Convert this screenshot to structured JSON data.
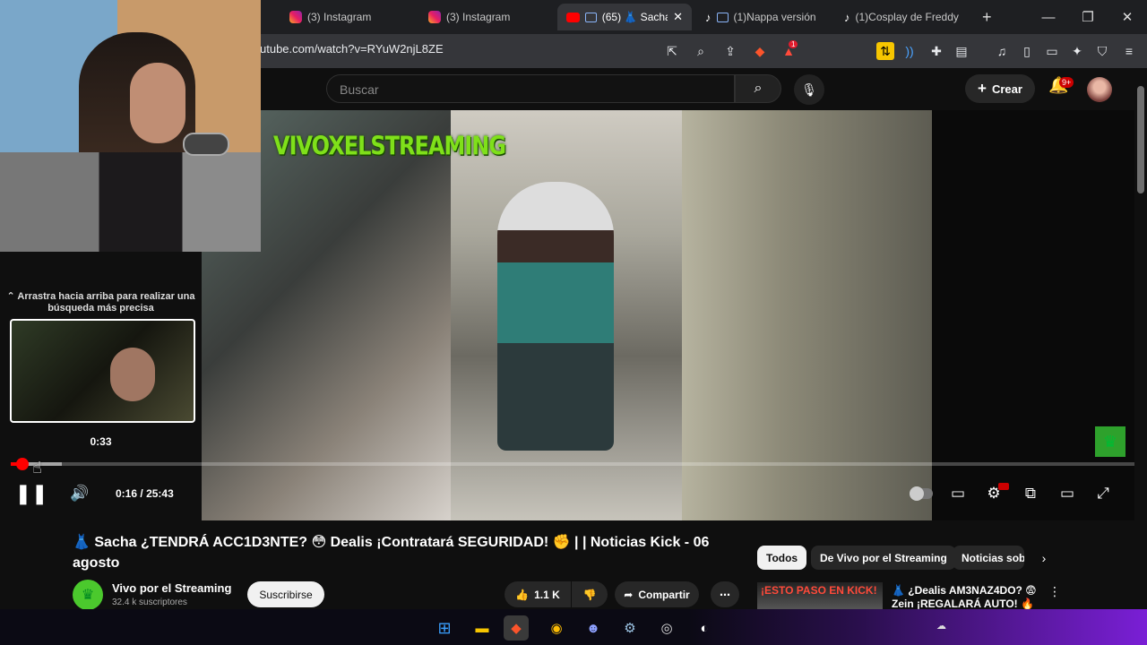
{
  "browser": {
    "tabs": [
      {
        "label": "(3) Instagram",
        "icon": "instagram-icon"
      },
      {
        "label": "(3) Instagram",
        "icon": "instagram-icon"
      },
      {
        "label": "(65) 👗 Sacha",
        "icon": "youtube-icon",
        "active": true
      },
      {
        "label": "(1)Nappa versión",
        "icon": "tiktok-icon"
      },
      {
        "label": "(1)Cosplay de Freddy",
        "icon": "tiktok-icon"
      }
    ],
    "new_tab": "+",
    "url": "utube.com/watch?v=RYuW2njL8ZE",
    "brave_badge": "1"
  },
  "youtube": {
    "search_placeholder": "Buscar",
    "create_label": "Crear",
    "notif_badge": "9+"
  },
  "video": {
    "watermark": "VIVOXELSTREAMING",
    "current_time": "0:16",
    "separator": "/",
    "duration": "25:43",
    "progress_fraction": 0.0104,
    "seek_hint": "⌃ Arrastra hacia arriba para realizar una búsqueda más precisa",
    "preview_time": "0:33"
  },
  "details": {
    "title": "👗 Sacha ¿TENDRÁ ACC1D3NTE? 😳 Dealis ¡Contratará SEGURIDAD! ✊ | | Noticias Kick - 06 agosto",
    "channel_name": "Vivo por el Streaming",
    "subscribers": "32.4 k suscriptores",
    "subscribe_label": "Suscribirse",
    "likes": "1.1 K",
    "share_label": "Compartir"
  },
  "sidebar": {
    "chips": [
      "Todos",
      "De Vivo por el Streaming",
      "Noticias sob"
    ],
    "rec_thumb_text": "¡ESTO PASO EN KICK!",
    "rec_title": "👗 ¿Dealis AM3NAZ4DO? 😨 Zein ¡REGALARÁ AUTO! 🔥 GT"
  },
  "colors": {
    "accent": "#ff0000",
    "watermark": "#7fe01a",
    "bg": "#0f0f0f"
  }
}
